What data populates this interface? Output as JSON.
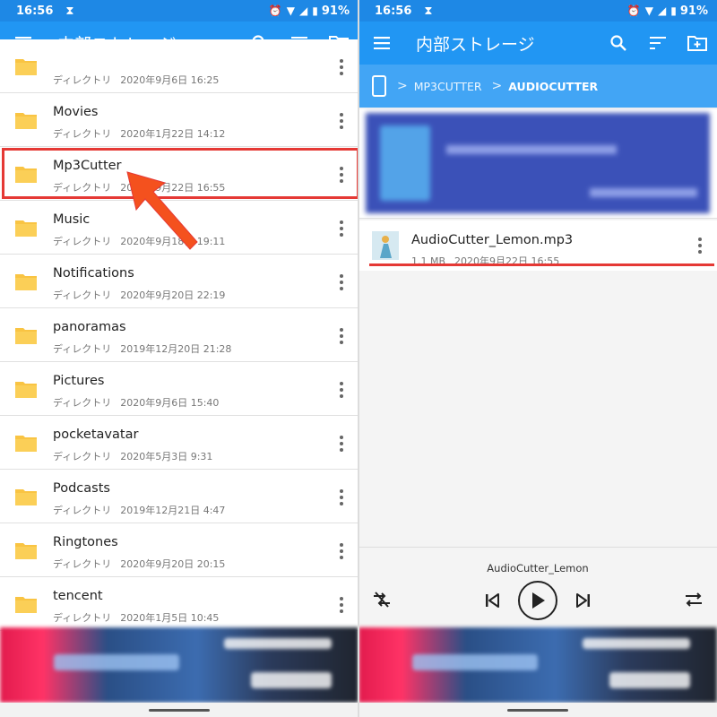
{
  "status_bar": {
    "time": "16:56",
    "battery": "91%"
  },
  "app_bar": {
    "title": "内部ストレージ"
  },
  "folder_rows": [
    {
      "name": "",
      "type": "ディレクトリ",
      "date": "2020年9月6日 16:25"
    },
    {
      "name": "Movies",
      "type": "ディレクトリ",
      "date": "2020年1月22日 14:12"
    },
    {
      "name": "Mp3Cutter",
      "type": "ディレクトリ",
      "date": "2020年9月22日 16:55"
    },
    {
      "name": "Music",
      "type": "ディレクトリ",
      "date": "2020年9月18日 19:11"
    },
    {
      "name": "Notifications",
      "type": "ディレクトリ",
      "date": "2020年9月20日 22:19"
    },
    {
      "name": "panoramas",
      "type": "ディレクトリ",
      "date": "2019年12月20日 21:28"
    },
    {
      "name": "Pictures",
      "type": "ディレクトリ",
      "date": "2020年9月6日 15:40"
    },
    {
      "name": "pocketavatar",
      "type": "ディレクトリ",
      "date": "2020年5月3日 9:31"
    },
    {
      "name": "Podcasts",
      "type": "ディレクトリ",
      "date": "2019年12月21日 4:47"
    },
    {
      "name": "Ringtones",
      "type": "ディレクトリ",
      "date": "2020年9月20日 20:15"
    },
    {
      "name": "tencent",
      "type": "ディレクトリ",
      "date": "2020年1月5日 10:45"
    }
  ],
  "breadcrumb": {
    "items": [
      "MP3CUTTER",
      "AUDIOCUTTER"
    ]
  },
  "file": {
    "name": "AudioCutter_Lemon.mp3",
    "size": "1.1 MB",
    "date": "2020年9月22日 16:55"
  },
  "player": {
    "track_title": "AudioCutter_Lemon"
  },
  "colors": {
    "status_bar": "#1e88e5",
    "app_bar": "#2196f3",
    "breadcrumb_bar": "#42a5f5",
    "folder": "#f9c443",
    "annotation": "#e53935"
  },
  "icons": {
    "app_bar": [
      "menu-icon",
      "search-icon",
      "sort-icon",
      "new-folder-icon"
    ],
    "status": [
      "hourglass-icon",
      "alarm-icon",
      "wifi-icon",
      "signal-icon",
      "battery-icon"
    ],
    "player": [
      "shuffle-off-icon",
      "skip-previous-icon",
      "play-icon",
      "skip-next-icon",
      "repeat-icon"
    ]
  }
}
